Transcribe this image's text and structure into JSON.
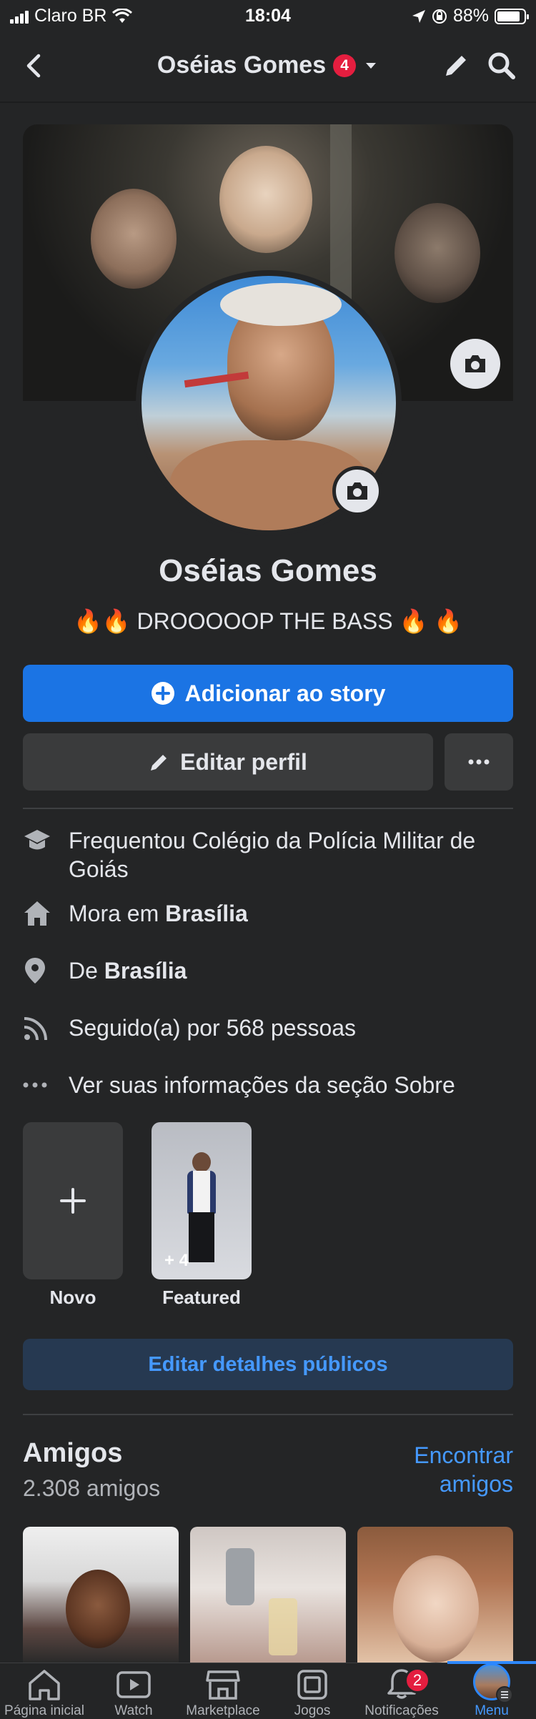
{
  "status_bar": {
    "carrier": "Claro BR",
    "time": "18:04",
    "battery": "88%"
  },
  "header": {
    "title": "Oséias Gomes",
    "badge": "4"
  },
  "profile": {
    "name": "Oséias Gomes",
    "bio": "🔥🔥 DROOOOOP THE BASS 🔥 🔥"
  },
  "buttons": {
    "add_story": "Adicionar ao story",
    "edit_profile": "Editar perfil",
    "edit_public": "Editar detalhes públicos"
  },
  "intro": {
    "school": "Frequentou Colégio da Polícia Militar de Goiás",
    "lives_prefix": "Mora em ",
    "lives_city": "Brasília",
    "from_prefix": "De ",
    "from_city": "Brasília",
    "followers": "Seguido(a) por 568 pessoas",
    "about": "Ver suas informações da seção Sobre"
  },
  "highlights": {
    "new_label": "Novo",
    "featured_label": "Featured",
    "featured_count": "+ 4"
  },
  "friends": {
    "title": "Amigos",
    "count": "2.308 amigos",
    "find": "Encontrar amigos"
  },
  "tabbar": {
    "home": "Página inicial",
    "watch": "Watch",
    "marketplace": "Marketplace",
    "games": "Jogos",
    "notifications": "Notificações",
    "notifications_badge": "2",
    "menu": "Menu"
  },
  "colors": {
    "background": "#242526",
    "accent": "#1b74e4",
    "link": "#4599ff",
    "badge": "#e41e3f"
  }
}
